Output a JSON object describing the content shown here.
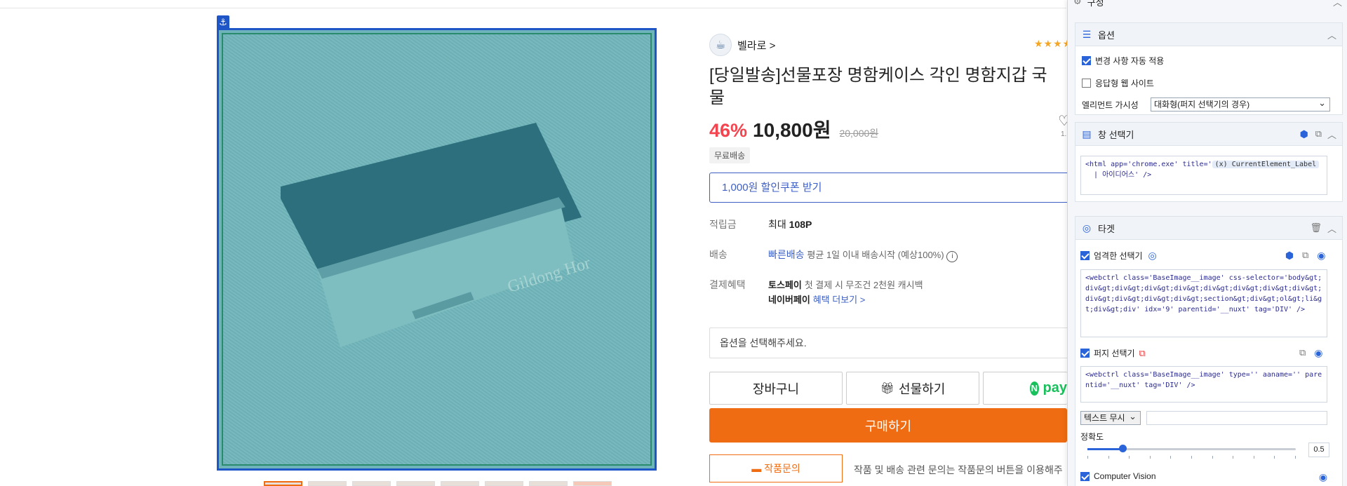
{
  "product": {
    "seller_name": "벨라로 >",
    "stars": "★★★★★",
    "title": "[당일발송]선물포장 명함케이스 각인 명함지갑 국",
    "title_line2": "물",
    "discount": "46%",
    "price": "10,800원",
    "original_price": "20,000원",
    "shipping_badge": "무료배송",
    "coupon_label": "1,000원 할인쿠폰 받기",
    "points": {
      "label": "적립금",
      "prefix": "최대",
      "value": "108P"
    },
    "delivery": {
      "label": "배송",
      "fast": "빠른배송",
      "note": "평균 1일 이내 배송시작 (예상100%)"
    },
    "payment": {
      "label": "결제혜택",
      "toss": "토스페이",
      "toss_note": "첫 결제 시 무조건 2천원 캐시백",
      "naver": "네이버페이",
      "naver_link": "혜택 더보기 >"
    },
    "engraving_text": "Gildong Hong",
    "option_placeholder": "옵션을 선택해주세요.",
    "cart_label": "장바구니",
    "gift_label": "선물하기",
    "npay_label": "pay",
    "buy_label": "구매하기",
    "inquiry_label": "작품문의",
    "inquiry_note": "작품 및 배송 관련 문의는 작품문의 버튼을 이용해주",
    "wishlist_count": "1."
  },
  "panel": {
    "config_title": "구성",
    "options_title": "옵션",
    "auto_apply": "변경 사항 자동 적용",
    "responsive_site": "응답형 웹 사이트",
    "visibility_label": "엘리먼트 가시성",
    "visibility_value": "대화형(퍼지 선택기의 경우)",
    "window_selector_title": "창 선택기",
    "window_code_head": "<html app='chrome.exe' title='",
    "window_code_chip": "(x) CurrentElement_Label",
    "window_code_tail": "| 아이디어스' />",
    "target_title": "타겟",
    "strict_selector": "엄격한 선택기",
    "strict_code": "<webctrl class='BaseImage__image' css-selector='body&gt;div&gt;div&gt;div&gt;div&gt;div&gt;div&gt;div&gt;div&gt;div&gt;div&gt;div&gt;div&gt;section&gt;div&gt;ol&gt;li&gt;div&gt;div' idx='9' parentid='__nuxt' tag='DIV' />",
    "fuzzy_selector": "퍼지 선택기",
    "fuzzy_code": "<webctrl class='BaseImage__image' type='' aaname='' parentid='__nuxt' tag='DIV' />",
    "text_ignore": "텍스트 무시",
    "accuracy_label": "정확도",
    "accuracy_value": "0.5",
    "computer_vision": "Computer Vision"
  },
  "colors": {
    "accent_orange": "#ef6c12",
    "discount_red": "#f2454f",
    "link_blue": "#3d5fc4",
    "selection_blue": "#1f56c7"
  }
}
